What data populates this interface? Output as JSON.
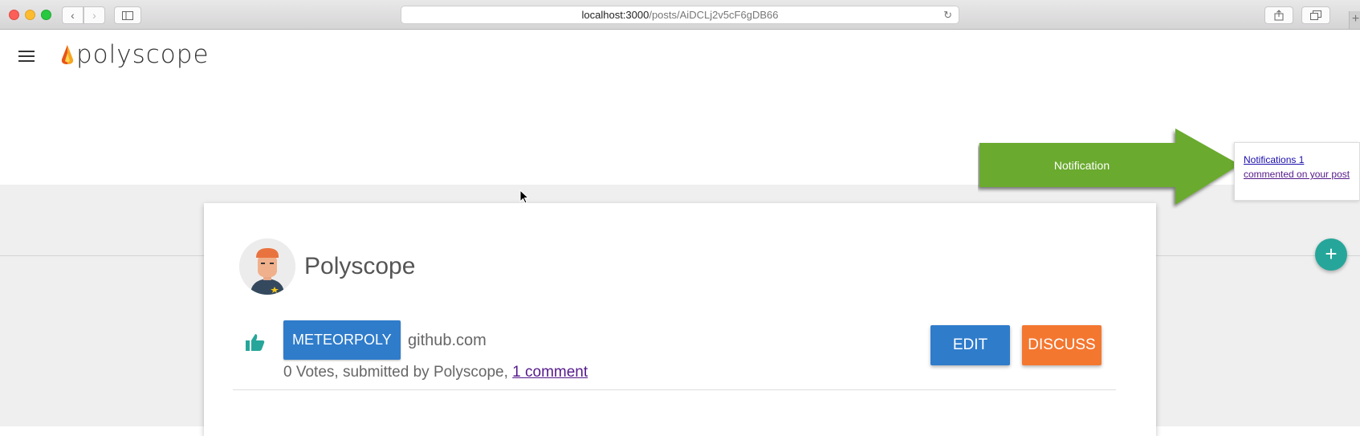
{
  "browser": {
    "url_host": "localhost:3000",
    "url_path": "/posts/AiDCLj2v5cF6gDB66"
  },
  "header": {
    "logo_text": "polyscope"
  },
  "post": {
    "author": "Polyscope",
    "category": "METEORPOLY",
    "domain": "github.com",
    "meta_prefix": "0 Votes, submitted by Polyscope, ",
    "comment_link": "1 comment",
    "edit_label": "EDIT",
    "discuss_label": "DISCUSS"
  },
  "notification": {
    "arrow_label": "Notification",
    "link_line1": "Notifications 1",
    "link_line2": "commented on your post"
  },
  "fab": {
    "label": "+"
  },
  "colors": {
    "primary_blue": "#2f7ccb",
    "discuss_orange": "#f47730",
    "arrow_green": "#6aaa2e",
    "fab_teal": "#26a69a"
  }
}
